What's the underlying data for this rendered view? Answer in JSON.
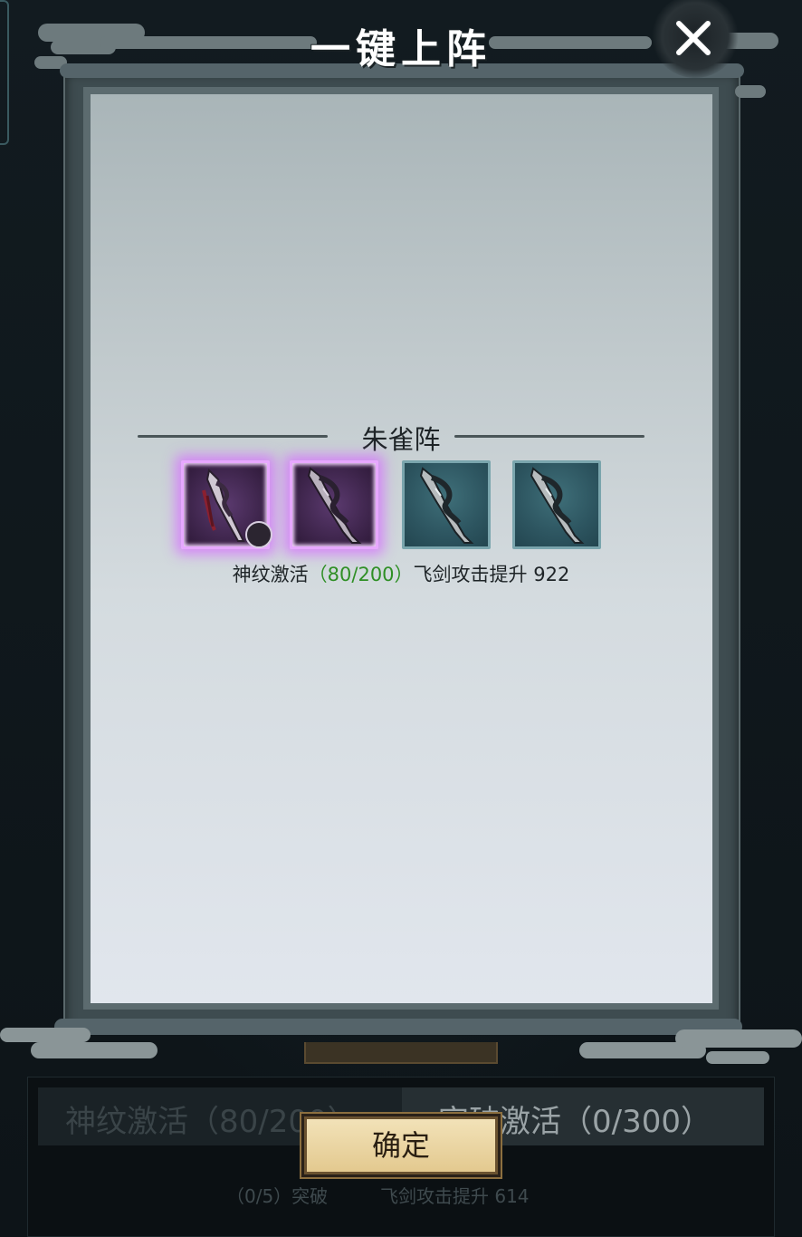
{
  "dialog": {
    "title": "一键上阵",
    "close_icon": "close-icon"
  },
  "formation": {
    "name": "朱雀阵",
    "slots": [
      {
        "quality": "purple",
        "icon": "flying-sword-icon",
        "has_rune_badge": true
      },
      {
        "quality": "purple",
        "icon": "flying-sword-icon",
        "has_rune_badge": false
      },
      {
        "quality": "teal",
        "icon": "flying-sword-icon",
        "has_rune_badge": false
      },
      {
        "quality": "teal",
        "icon": "flying-sword-icon",
        "has_rune_badge": false
      }
    ],
    "info": {
      "rune_label": "神纹激活",
      "rune_progress": "（80/200）",
      "bonus_label": "飞剑攻击提升",
      "bonus_value": "922"
    }
  },
  "confirm_label": "确定",
  "background": {
    "tab_left": "神纹激活（80/200）",
    "tab_right": "突破激活（0/300）",
    "footer_left": "（0/5）突破",
    "footer_right": "飞剑攻击提升 614"
  },
  "colors": {
    "purple_glow": "#d66eff",
    "progress_green": "#2f8f25",
    "button_gold": "#e3c98f"
  }
}
